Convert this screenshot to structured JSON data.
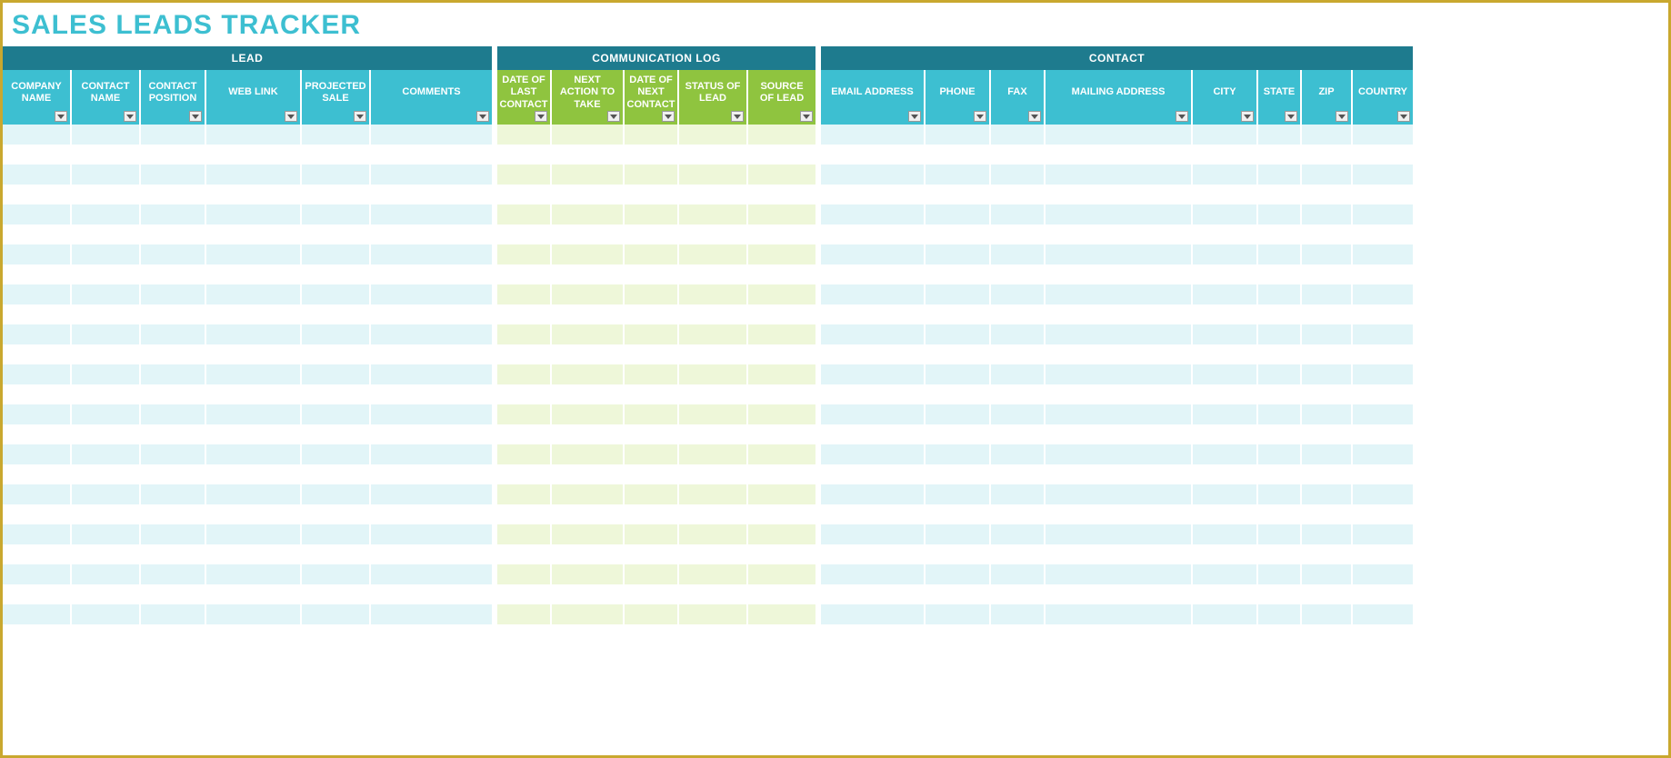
{
  "title": "SALES LEADS TRACKER",
  "groups": [
    {
      "label": "LEAD",
      "class": "group-lead group-lead-w"
    },
    {
      "label": "COMMUNICATION LOG",
      "class": "group-comm group-comm-w"
    },
    {
      "label": "CONTACT",
      "class": "group-contact group-contact-w"
    }
  ],
  "columns": [
    {
      "label": "COMPANY NAME",
      "section": "lead",
      "w": "w-company-name"
    },
    {
      "label": "CONTACT NAME",
      "section": "lead",
      "w": "w-contact-name"
    },
    {
      "label": "CONTACT POSITION",
      "section": "lead",
      "w": "w-contact-position"
    },
    {
      "label": "WEB LINK",
      "section": "lead",
      "w": "w-web-link"
    },
    {
      "label": "PROJECTED SALE",
      "section": "lead",
      "w": "w-projected-sale"
    },
    {
      "label": "COMMENTS",
      "section": "lead",
      "w": "w-comments"
    },
    {
      "label": "DATE OF LAST CONTACT",
      "section": "comm",
      "w": "w-date-last"
    },
    {
      "label": "NEXT ACTION TO TAKE",
      "section": "comm",
      "w": "w-next-action"
    },
    {
      "label": "DATE OF NEXT CONTACT",
      "section": "comm",
      "w": "w-date-next"
    },
    {
      "label": "STATUS OF LEAD",
      "section": "comm",
      "w": "w-status"
    },
    {
      "label": "SOURCE OF LEAD",
      "section": "comm",
      "w": "w-source"
    },
    {
      "label": "EMAIL ADDRESS",
      "section": "contact",
      "w": "w-email"
    },
    {
      "label": "PHONE",
      "section": "contact",
      "w": "w-phone"
    },
    {
      "label": "FAX",
      "section": "contact",
      "w": "w-fax"
    },
    {
      "label": "MAILING ADDRESS",
      "section": "contact",
      "w": "w-mailing"
    },
    {
      "label": "CITY",
      "section": "contact",
      "w": "w-city"
    },
    {
      "label": "STATE",
      "section": "contact",
      "w": "w-state"
    },
    {
      "label": "ZIP",
      "section": "contact",
      "w": "w-zip"
    },
    {
      "label": "COUNTRY",
      "section": "contact",
      "w": "w-country"
    }
  ],
  "row_count": 26
}
